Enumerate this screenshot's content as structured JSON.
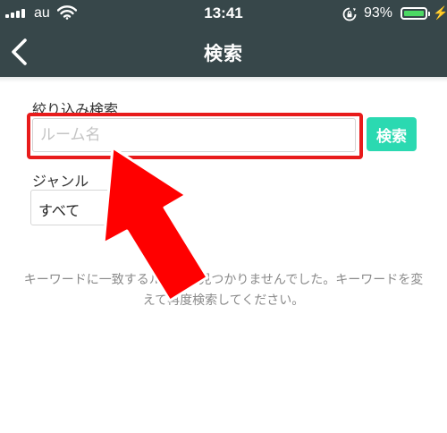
{
  "status_bar": {
    "carrier": "au",
    "time": "13:41",
    "battery_percent": "93%",
    "battery_level": 0.93,
    "icons": [
      "signal-icon",
      "wifi-icon",
      "rotation-lock-icon",
      "battery-icon",
      "charging-bolt-icon"
    ]
  },
  "nav": {
    "title": "検索",
    "back_icon": "chevron-left-icon"
  },
  "filter": {
    "label": "絞り込み検索",
    "placeholder": "ルーム名",
    "value": "",
    "button_label": "検索"
  },
  "genre": {
    "label": "ジャンル",
    "selected": "すべて"
  },
  "empty_message": "キーワードに一致するルームは見つかりませんでした。キーワードを変えて再度検索してください。",
  "annotations": {
    "highlight_color": "#e81b1b",
    "arrow_color": "#ff0000"
  },
  "colors": {
    "header_bg": "#37474a",
    "accent": "#2bd9b1"
  }
}
